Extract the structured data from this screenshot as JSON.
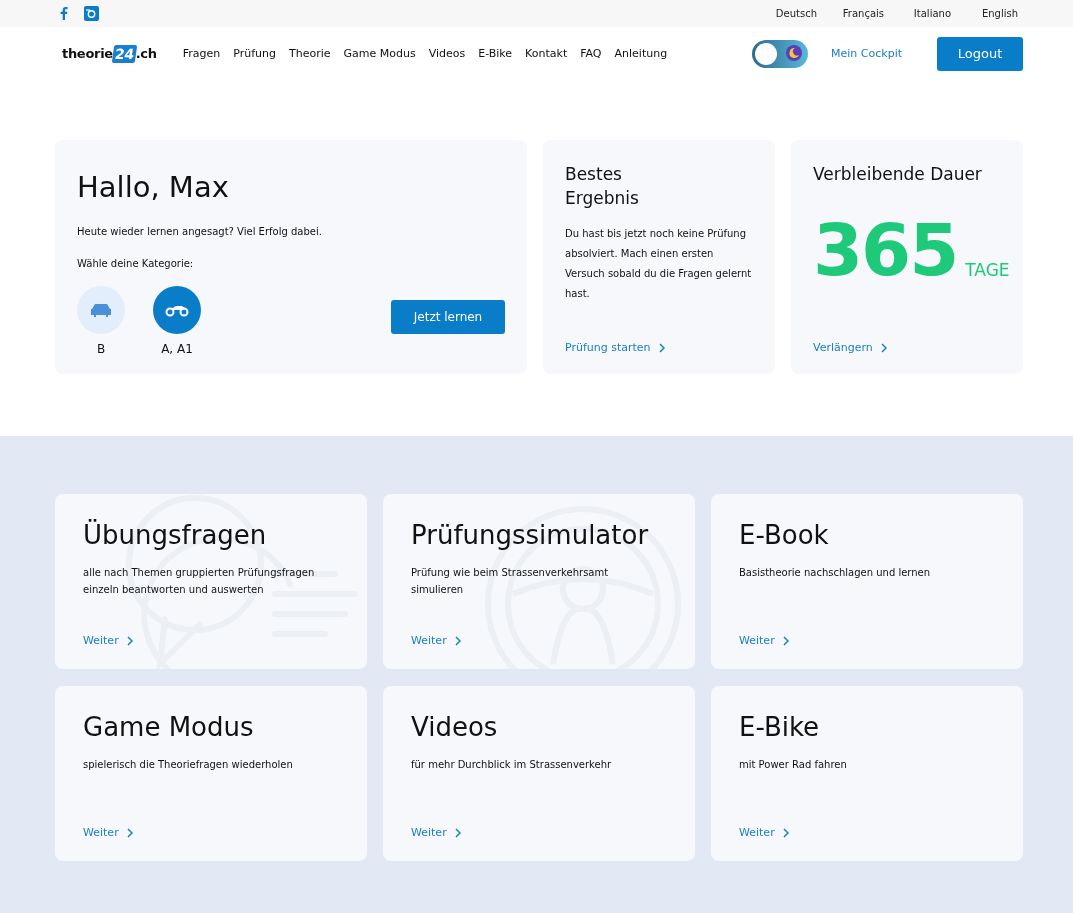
{
  "topbar": {
    "social": [
      {
        "kind": "facebook"
      },
      {
        "kind": "instagram"
      }
    ],
    "languages": [
      "Deutsch",
      "Français",
      "Italiano",
      "English"
    ]
  },
  "nav": {
    "logo": {
      "prefix": "theorie",
      "mark": "24",
      "suffix": ".ch"
    },
    "links": [
      "Fragen",
      "Prüfung",
      "Theorie",
      "Game Modus",
      "Videos",
      "E-Bike",
      "Kontakt",
      "FAQ",
      "Anleitung"
    ],
    "dark_mode": {
      "on": false
    },
    "cockpit": "Mein Cockpit",
    "logout": "Logout"
  },
  "welcome": {
    "title": "Hallo, Max",
    "text": "Heute wieder lernen angesagt? Viel Erfolg dabei.",
    "prompt": "Wähle deine Kategorie:",
    "categories": [
      {
        "kind": "car",
        "label": "B",
        "selected": false
      },
      {
        "kind": "motorcycle",
        "label": "A, A1",
        "selected": true
      }
    ],
    "button": "Jetzt lernen"
  },
  "best_result": {
    "title": "Bestes Ergebnis",
    "text": "Du hast bis jetzt noch keine Prüfung absolviert. Mach einen ersten Versuch sobald du die Fragen gelernt hast.",
    "link": "Prüfung starten"
  },
  "remaining": {
    "title": "Verbleibende Dauer",
    "value": "365",
    "unit": "TAGE",
    "link": "Verlängern"
  },
  "features": [
    {
      "title": "Übungsfragen",
      "text": "alle nach Themen gruppierten Prüfungsfragen einzeln beantworten und auswerten",
      "link": "Weiter",
      "kind": "chat"
    },
    {
      "title": "Prüfungssimulator",
      "text": "Prüfung wie beim Strassenverkehrsamt simulieren",
      "link": "Weiter",
      "kind": "wheel"
    },
    {
      "title": "E-Book",
      "text": "Basistheorie nachschlagen und lernen",
      "link": "Weiter"
    },
    {
      "title": "Game Modus",
      "text": "spielerisch die Theoriefragen wiederholen",
      "link": "Weiter"
    },
    {
      "title": "Videos",
      "text": "für mehr Durchblick im Strassenverkehr",
      "link": "Weiter"
    },
    {
      "title": "E-Bike",
      "text": "mit Power Rad fahren",
      "link": "Weiter"
    }
  ]
}
